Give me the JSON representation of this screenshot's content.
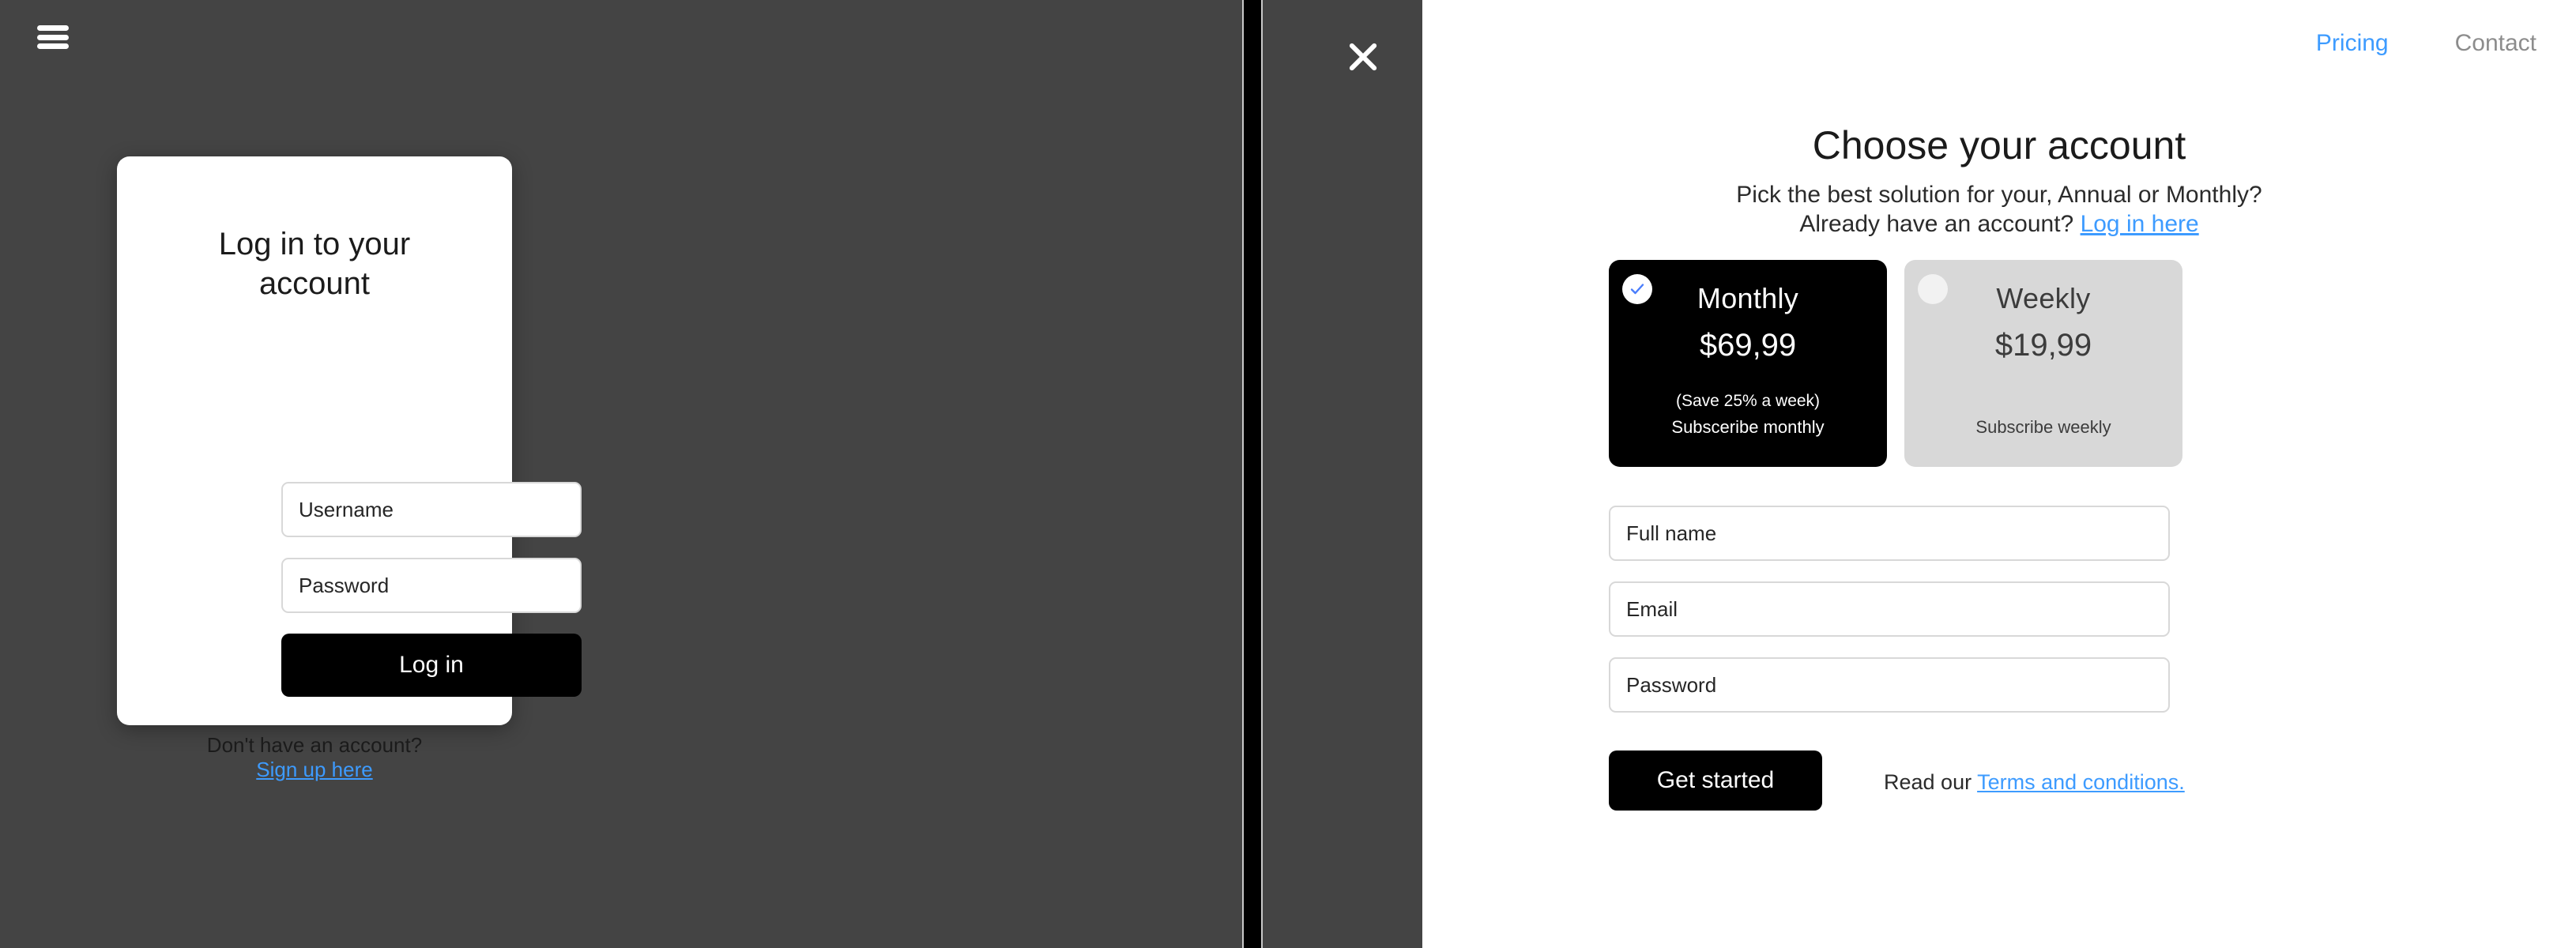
{
  "overlay": {
    "menu_icon": "hamburger-icon",
    "close_icon": "close-icon"
  },
  "login": {
    "title": "Log in to your account",
    "username_placeholder": "Username",
    "username_value": "",
    "password_placeholder": "Password",
    "password_value": "",
    "submit_label": "Log in",
    "footer_text": "Don't have an account?",
    "footer_link": "Sign up here"
  },
  "signup": {
    "nav": {
      "pricing": "Pricing",
      "contact": "Contact"
    },
    "title": "Choose your account",
    "subtitle_line1": "Pick the best solution for your, Annual or Monthly?",
    "subtitle_line2_prefix": "Already have an account? ",
    "subtitle_link": "Log in here",
    "plans": [
      {
        "name": "Monthly",
        "price": "$69,99",
        "save_note": "(Save 25% a week)",
        "subscribe_note": "Subsceribe monthly",
        "selected": true,
        "radio_icon": "check-circle-icon"
      },
      {
        "name": "Weekly",
        "price": "$19,99",
        "save_note": "",
        "subscribe_note": "Subscribe weekly",
        "selected": false,
        "radio_icon": "empty-circle-icon"
      }
    ],
    "fields": {
      "fullname_placeholder": "Full name",
      "fullname_value": "",
      "email_placeholder": "Email",
      "email_value": "",
      "password_placeholder": "Password",
      "password_value": ""
    },
    "submit_label": "Get started",
    "terms_prefix": "Read our ",
    "terms_link": "Terms and conditions."
  },
  "colors": {
    "overlay_bg": "#444444",
    "accent_link": "#3d9bff",
    "plan_selected_bg": "#000000",
    "plan_unselected_bg": "#d8d8d8",
    "nav_inactive": "#8c8c8c",
    "check_blue": "#4a7dfc"
  }
}
